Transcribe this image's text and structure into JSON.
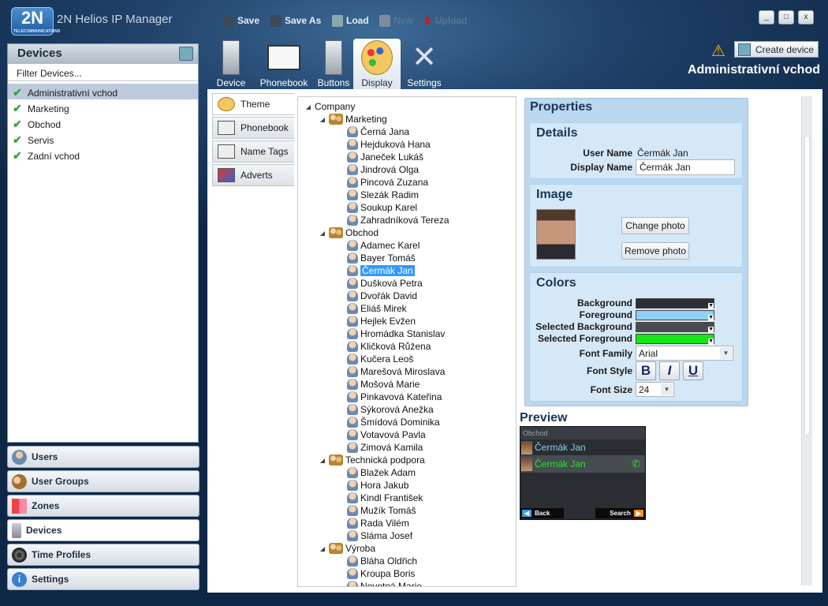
{
  "app": {
    "logo": "2N",
    "logo_sub": "TELECOMMUNICATIONS",
    "title": "2N Helios IP Manager"
  },
  "toolbar": {
    "save": "Save",
    "save_as": "Save As",
    "load": "Load",
    "new": "New",
    "upload": "Upload"
  },
  "window": {
    "minimize": "_",
    "maximize": "□",
    "close": "x"
  },
  "devices": {
    "title": "Devices",
    "filter": "Filter Devices...",
    "items": [
      "Administrativní vchod",
      "Marketing",
      "Obchod",
      "Servis",
      "Zadní vchod"
    ],
    "selected": 0
  },
  "nav": [
    "Users",
    "User Groups",
    "Zones",
    "Devices",
    "Time Profiles",
    "Settings"
  ],
  "tabs": [
    "Device",
    "Phonebook",
    "Buttons",
    "Display",
    "Settings"
  ],
  "create_device": "Create device",
  "device_name": "Administrativní vchod",
  "subtabs": [
    "Theme",
    "Phonebook",
    "Name Tags",
    "Adverts"
  ],
  "tree": {
    "root": "Company",
    "groups": [
      {
        "name": "Marketing",
        "members": [
          "Černá Jana",
          "Hejduková Hana",
          "Janeček Lukáš",
          "Jindrová Olga",
          "Pincová Zuzana",
          "Slezák Radim",
          "Soukup Karel",
          "Zahradníková Tereza"
        ]
      },
      {
        "name": "Obchod",
        "members": [
          "Adamec Karel",
          "Bayer Tomáš",
          "Čermák Jan",
          "Dušková Petra",
          "Dvořák David",
          "Eliáš Mirek",
          "Hejlek Evžen",
          "Hromádka Stanislav",
          "Kličková Růžena",
          "Kučera Leoš",
          "Marešová Miroslava",
          "Mošová Marie",
          "Pinkavová Kateřina",
          "Sýkorová Anežka",
          "Šmídová Dominika",
          "Votavová Pavla",
          "Zimová Kamila"
        ]
      },
      {
        "name": "Technická podpora",
        "members": [
          "Blažek Adam",
          "Hora Jakub",
          "Kindl František",
          "Mužík Tomáš",
          "Rada Vilém",
          "Sláma Josef"
        ]
      },
      {
        "name": "Výroba",
        "members": [
          "Bláha Oldřich",
          "Kroupa Boris",
          "Novotná Marie"
        ]
      }
    ],
    "selected": "Čermák Jan"
  },
  "props": {
    "title": "Properties",
    "details": {
      "title": "Details",
      "user_name_label": "User Name",
      "user_name": "Čermák Jan",
      "display_name_label": "Display Name",
      "display_name": "Čermák Jan"
    },
    "image": {
      "title": "Image",
      "change": "Change photo",
      "remove": "Remove photo"
    },
    "colors": {
      "title": "Colors",
      "background_label": "Background",
      "foreground_label": "Foreground",
      "sel_bg_label": "Selected Background",
      "sel_fg_label": "Selected Foreground",
      "background": "#2c2f33",
      "foreground": "#8fd0f5",
      "sel_bg": "#484c51",
      "sel_fg": "#16e516",
      "font_family_label": "Font Family",
      "font_family": "Arial",
      "font_style_label": "Font Style",
      "bold": "B",
      "italic": "I",
      "underline": "U",
      "font_size_label": "Font Size",
      "font_size": "24"
    }
  },
  "preview": {
    "title": "Preview",
    "header": "Obchod",
    "rows": [
      "Čermák Jan",
      "Čermák Jan"
    ],
    "back": "Back",
    "search": "Search"
  }
}
